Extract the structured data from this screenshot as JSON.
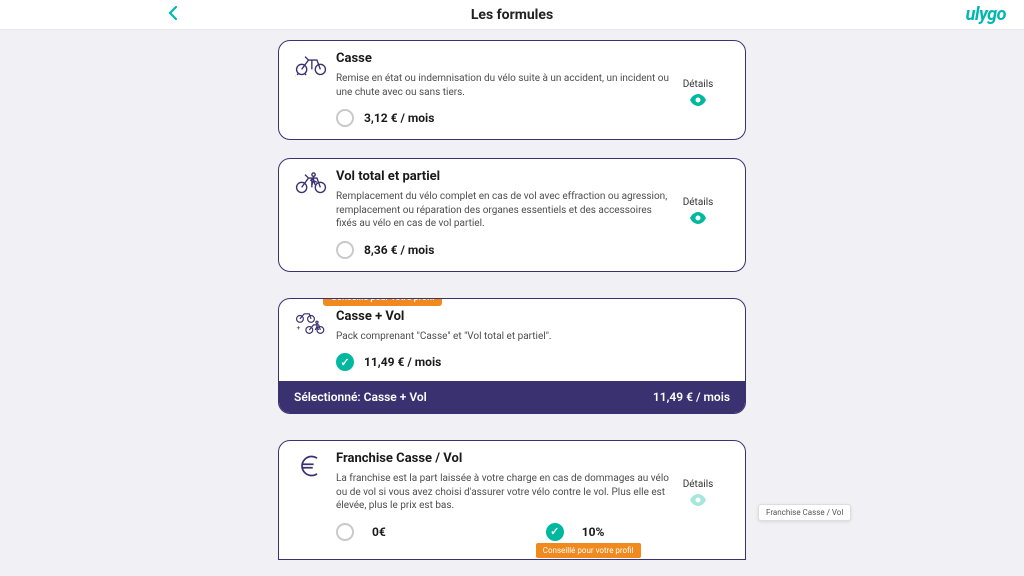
{
  "header": {
    "title": "Les formules",
    "logo": "ulygo"
  },
  "cards": {
    "casse": {
      "title": "Casse",
      "desc": "Remise en état ou indemnisation du vélo suite à un accident, un incident ou une chute avec ou sans tiers.",
      "price": "3,12 € / mois",
      "details": "Détails"
    },
    "vol": {
      "title": "Vol total et partiel",
      "desc": "Remplacement du vélo complet en cas de vol avec effraction ou agression, remplacement ou réparation des organes essentiels et des accessoires fixés au vélo en cas de vol partiel.",
      "price": "8,36 € / mois",
      "details": "Détails"
    },
    "combo": {
      "badge": "Conseillé pour votre profil",
      "title": "Casse + Vol",
      "desc": "Pack comprenant \"Casse\" et \"Vol total et partiel\".",
      "price": "11,49 € / mois",
      "selected_label": "Sélectionné: Casse + Vol",
      "selected_price": "11,49 € / mois"
    },
    "franchise": {
      "title": "Franchise Casse / Vol",
      "desc": "La franchise est la part laissée à votre charge en cas de dommages au vélo ou de vol si vous avez choisi d'assurer votre vélo contre le vol. Plus elle est élevée, plus le prix est bas.",
      "details": "Détails",
      "option0": "0€",
      "option10": "10%",
      "badge": "Conseillé pour votre profil"
    }
  },
  "tooltip": "Franchise Casse / Vol"
}
